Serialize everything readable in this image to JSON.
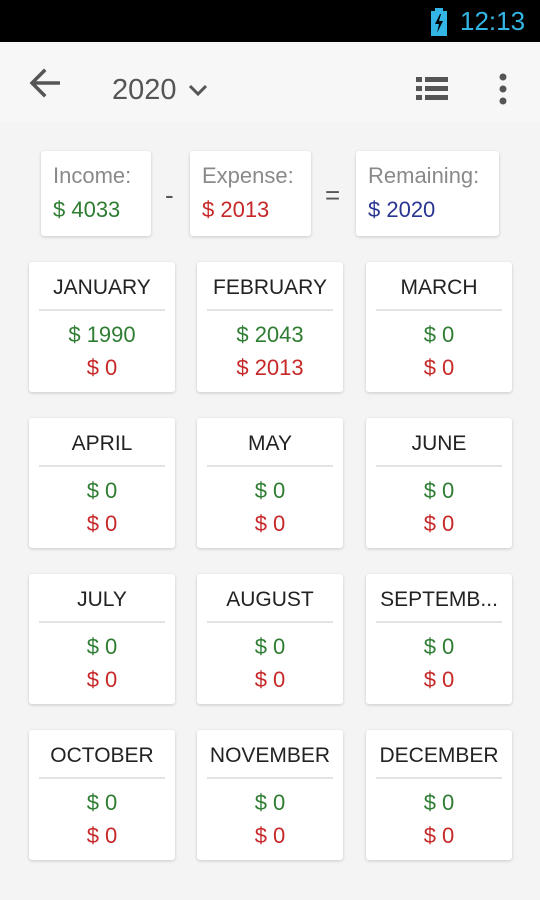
{
  "status_bar": {
    "time": "12:13",
    "battery_icon": "battery-charging-icon"
  },
  "app_bar": {
    "back_icon": "arrow-back-icon",
    "year": "2020",
    "year_dropdown_icon": "chevron-down-icon",
    "list_icon": "list-view-icon",
    "menu_icon": "more-vert-icon"
  },
  "summary": {
    "income_label": "Income:",
    "income_value": "$ 4033",
    "minus": "-",
    "expense_label": "Expense:",
    "expense_value": "$ 2013",
    "equals": "=",
    "remaining_label": "Remaining:",
    "remaining_value": "$ 2020"
  },
  "colors": {
    "income": "#2e7d32",
    "expense": "#c62828",
    "remaining": "#283593",
    "status_accent": "#33b5e5"
  },
  "months": [
    {
      "name": "JANUARY",
      "income": "$ 1990",
      "expense": "$ 0"
    },
    {
      "name": "FEBRUARY",
      "income": "$ 2043",
      "expense": "$ 2013"
    },
    {
      "name": "MARCH",
      "income": "$ 0",
      "expense": "$ 0"
    },
    {
      "name": "APRIL",
      "income": "$ 0",
      "expense": "$ 0"
    },
    {
      "name": "MAY",
      "income": "$ 0",
      "expense": "$ 0"
    },
    {
      "name": "JUNE",
      "income": "$ 0",
      "expense": "$ 0"
    },
    {
      "name": "JULY",
      "income": "$ 0",
      "expense": "$ 0"
    },
    {
      "name": "AUGUST",
      "income": "$ 0",
      "expense": "$ 0"
    },
    {
      "name": "SEPTEMB...",
      "income": "$ 0",
      "expense": "$ 0"
    },
    {
      "name": "OCTOBER",
      "income": "$ 0",
      "expense": "$ 0"
    },
    {
      "name": "NOVEMBER",
      "income": "$ 0",
      "expense": "$ 0"
    },
    {
      "name": "DECEMBER",
      "income": "$ 0",
      "expense": "$ 0"
    }
  ]
}
